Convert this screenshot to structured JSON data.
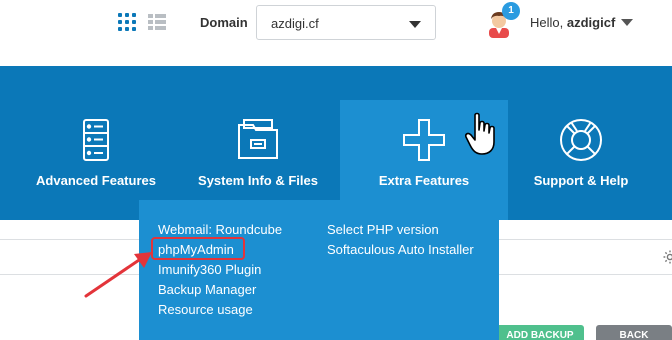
{
  "header": {
    "domain_label": "Domain",
    "domain_value": "azdigi.cf",
    "notification_count": "1",
    "greeting": "Hello,",
    "username": "azdigicf",
    "icons": [
      "grid-view-icon",
      "list-view-icon",
      "user-avatar-icon",
      "chevron-down-icon"
    ]
  },
  "nav": {
    "items": [
      {
        "label": "Advanced Features",
        "icon": "server-icon"
      },
      {
        "label": "System Info & Files",
        "icon": "folder-icon"
      },
      {
        "label": "Extra Features",
        "icon": "plus-icon",
        "active": true
      },
      {
        "label": "Support & Help",
        "icon": "lifebuoy-icon"
      }
    ]
  },
  "dropdown": {
    "left_column": [
      "Webmail: Roundcube",
      "phpMyAdmin",
      "Imunify360 Plugin",
      "Backup Manager",
      "Resource usage"
    ],
    "right_column": [
      "Select PHP version",
      "Softaculous Auto Installer"
    ],
    "highlighted": "phpMyAdmin"
  },
  "buttons": {
    "green_label": "ADD BACKUP",
    "gray_label": "BACK"
  },
  "colors": {
    "nav_bg": "#0b78b8",
    "nav_active_bg": "#1c8fd1",
    "highlight": "#e3343a",
    "badge": "#2a9be0"
  }
}
